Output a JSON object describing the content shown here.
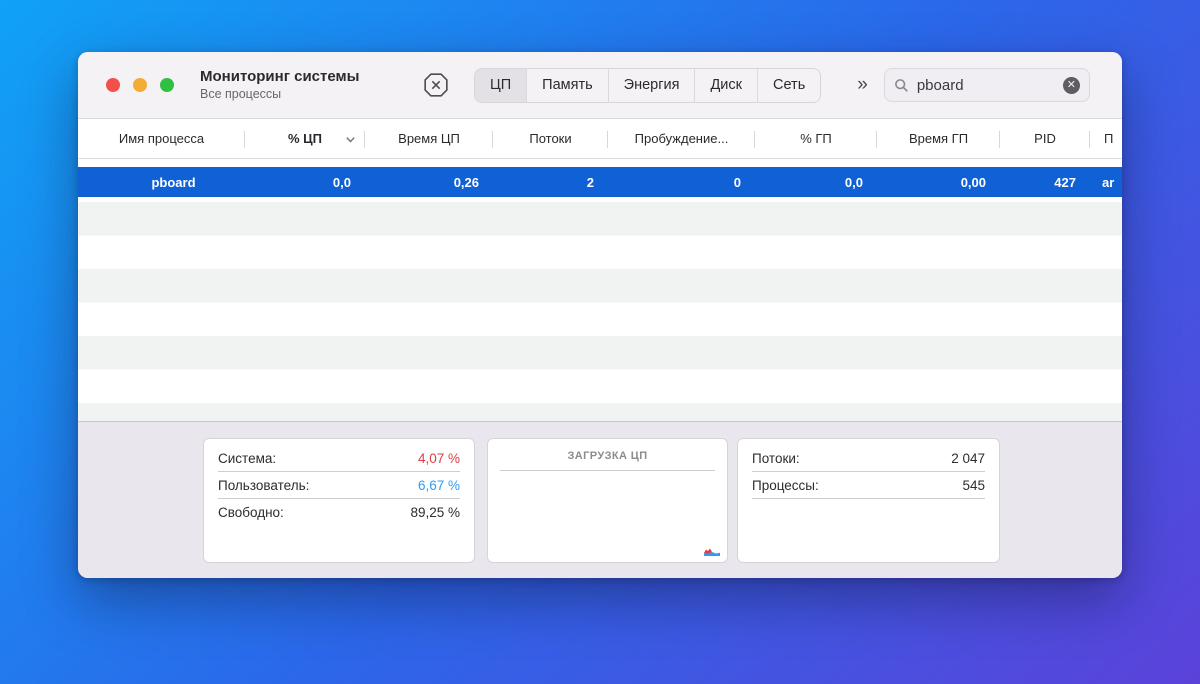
{
  "window": {
    "title": "Мониторинг системы",
    "subtitle": "Все процессы"
  },
  "toolbar": {
    "tabs": [
      {
        "label": "ЦП",
        "selected": true
      },
      {
        "label": "Память",
        "selected": false
      },
      {
        "label": "Энергия",
        "selected": false
      },
      {
        "label": "Диск",
        "selected": false
      },
      {
        "label": "Сеть",
        "selected": false
      }
    ],
    "overflow_label": "»",
    "search": {
      "value": "pboard"
    }
  },
  "table": {
    "columns": [
      {
        "label": "Имя процесса"
      },
      {
        "label": "% ЦП",
        "sorted": "desc"
      },
      {
        "label": "Время ЦП"
      },
      {
        "label": "Потоки"
      },
      {
        "label": "Пробуждение..."
      },
      {
        "label": "% ГП"
      },
      {
        "label": "Время ГП"
      },
      {
        "label": "PID"
      },
      {
        "label": "П"
      }
    ],
    "selected_row": {
      "values": [
        "pboard",
        "0,0",
        "0,26",
        "2",
        "0",
        "0,0",
        "0,00",
        "427",
        "ar"
      ]
    }
  },
  "footer": {
    "cpu": {
      "rows": [
        {
          "label": "Система:",
          "value": "4,07 %"
        },
        {
          "label": "Пользователь:",
          "value": "6,67 %"
        },
        {
          "label": "Свободно:",
          "value": "89,25 %"
        }
      ]
    },
    "chart": {
      "title": "ЗАГРУЗКА ЦП"
    },
    "counts": {
      "rows": [
        {
          "label": "Потоки:",
          "value": "2 047"
        },
        {
          "label": "Процессы:",
          "value": "545"
        }
      ]
    }
  },
  "colors": {
    "selection_blue": "#1061d5",
    "system_red": "#e23b41",
    "user_blue": "#2f9bf2",
    "background_gradient": [
      "#10a2f6",
      "#5b42d9"
    ]
  }
}
